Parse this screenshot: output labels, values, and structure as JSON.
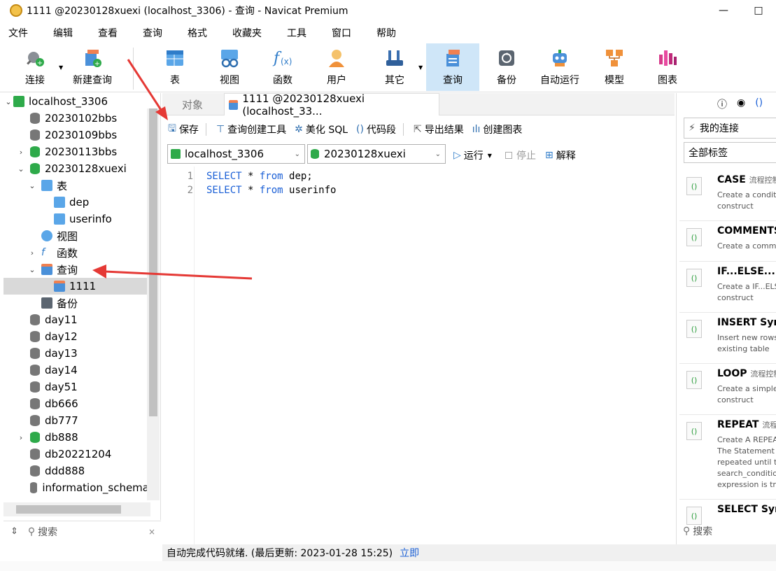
{
  "window": {
    "title": "1111 @20230128xuexi (localhost_3306) - 查询 - Navicat Premium",
    "minimize": "—",
    "maximize": "□"
  },
  "menu": [
    "文件",
    "编辑",
    "查看",
    "查询",
    "格式",
    "收藏夹",
    "工具",
    "窗口",
    "帮助"
  ],
  "toolbar": {
    "connect": "连接",
    "new_query": "新建查询",
    "table": "表",
    "view": "视图",
    "function": "函数",
    "user": "用户",
    "other": "其它",
    "query": "查询",
    "backup": "备份",
    "auto_run": "自动运行",
    "model": "模型",
    "chart": "图表"
  },
  "tree": {
    "connection": "localhost_3306",
    "databases_top": [
      "20230102bbs",
      "20230109bbs",
      "20230113bbs",
      "20230128xuexi"
    ],
    "table_group": "表",
    "tables": [
      "dep",
      "userinfo"
    ],
    "view_group": "视图",
    "function_group": "函数",
    "query_group": "查询",
    "query_item": "1111",
    "backup_group": "备份",
    "databases_bottom": [
      "day11",
      "day12",
      "day13",
      "day14",
      "day51",
      "db666",
      "db777",
      "db888",
      "db20221204",
      "ddd888",
      "information_schema"
    ],
    "search_placeholder": "搜索"
  },
  "tabs": {
    "object": "对象",
    "query_tab": "1111 @20230128xuexi (localhost_33..."
  },
  "query_toolbar": {
    "save": "保存",
    "builder": "查询创建工具",
    "beautify": "美化 SQL",
    "snippet": "代码段",
    "export": "导出结果",
    "create_chart": "创建图表"
  },
  "conbar": {
    "connection": "localhost_3306",
    "database": "20230128xuexi",
    "run": "运行",
    "stop": "停止",
    "explain": "解释"
  },
  "editor": {
    "lines": [
      {
        "num": "1",
        "kw1": "SELECT",
        "mid": " * ",
        "kw2": "from",
        "rest": " dep;"
      },
      {
        "num": "2",
        "kw1": "SELECT",
        "mid": " * ",
        "kw2": "from",
        "rest": " userinfo"
      }
    ]
  },
  "right": {
    "my_connection": "我的连接",
    "all_tags": "全部标签",
    "search_placeholder": "搜索",
    "snippets": [
      {
        "name": "CASE",
        "tag": "流程控制",
        "desc": "Create a conditio\nconstruct"
      },
      {
        "name": "COMMENTS",
        "tag": "",
        "desc": "Create a comme"
      },
      {
        "name": "IF...ELSE...",
        "tag": "流",
        "desc": "Create a IF...ELSE\nconstruct"
      },
      {
        "name": "INSERT Syn",
        "tag": "",
        "desc": "Insert new rows\nexisting table"
      },
      {
        "name": "LOOP",
        "tag": "流程控制",
        "desc": "Create a simple l\nconstruct"
      },
      {
        "name": "REPEAT",
        "tag": "流程",
        "desc": "Create A REPEAT\nThe Statement li\nrepeated until th\nsearch_condition\nexpression is tru"
      },
      {
        "name": "SELECT Syn",
        "tag": "",
        "desc": ""
      }
    ]
  },
  "status": {
    "text": "自动完成代码就绪. (最后更新: 2023-01-28 15:25)",
    "link": "立即"
  },
  "colors": {
    "accent": "#1a5fd6",
    "active_tab": "#cfe6f8",
    "arrow": "#e53935",
    "db_green": "#2eaa4a"
  }
}
